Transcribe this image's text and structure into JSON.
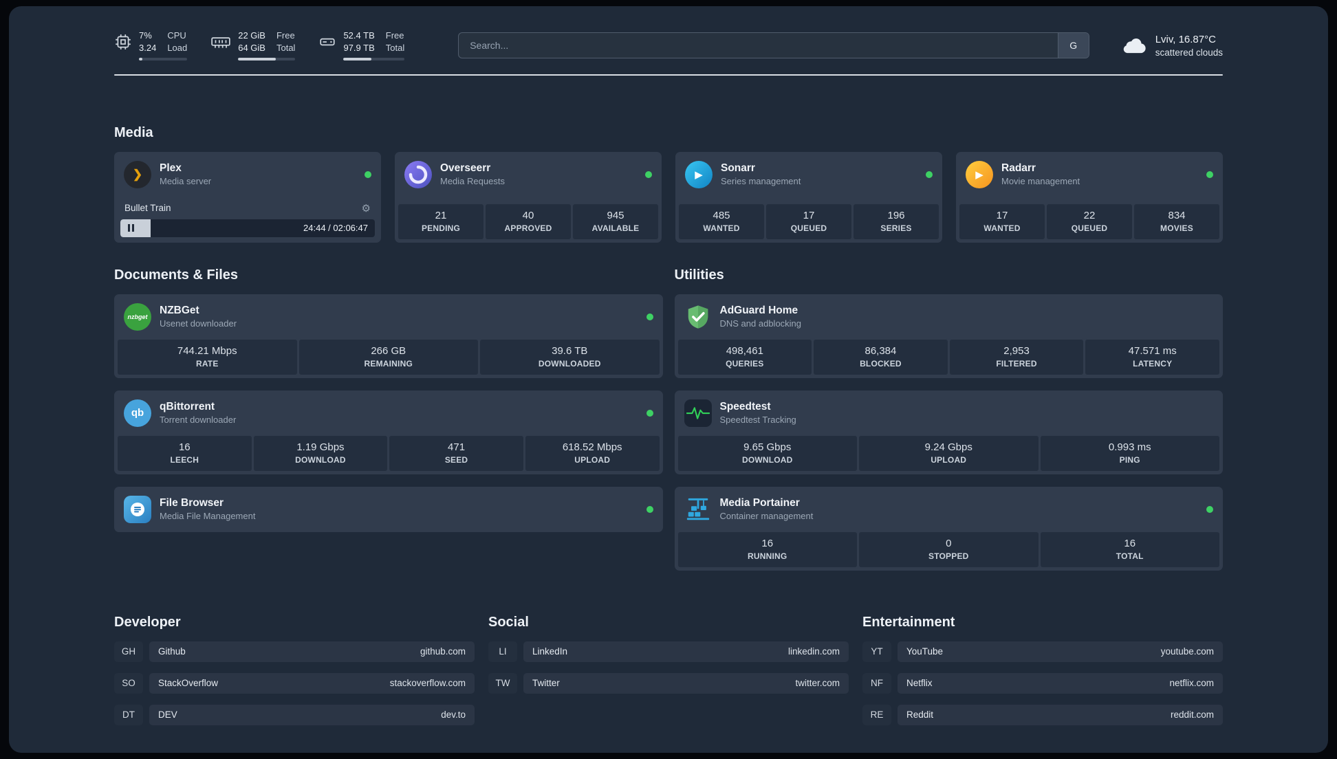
{
  "header": {
    "cpu": {
      "value_primary": "7%",
      "value_secondary": "3.24",
      "label_primary": "CPU",
      "label_secondary": "Load",
      "progress_pct": 7
    },
    "memory": {
      "value_primary": "22 GiB",
      "value_secondary": "64 GiB",
      "label_primary": "Free",
      "label_secondary": "Total",
      "progress_pct": 66
    },
    "disk": {
      "value_primary": "52.4 TB",
      "value_secondary": "97.9 TB",
      "label_primary": "Free",
      "label_secondary": "Total",
      "progress_pct": 46
    },
    "search": {
      "placeholder": "Search...",
      "engine_button": "G"
    },
    "weather": {
      "location": "Lviv, 16.87°C",
      "condition": "scattered clouds"
    }
  },
  "icons": {
    "gear": "⚙",
    "plex_chevron": "❯",
    "play": "▶",
    "nzbget_text": "nzbget",
    "qbittorrent_text": "qb"
  },
  "sections": {
    "media": "Media",
    "documents": "Documents & Files",
    "utilities": "Utilities",
    "developer": "Developer",
    "social": "Social",
    "entertainment": "Entertainment"
  },
  "services": {
    "plex": {
      "name": "Plex",
      "subtitle": "Media server",
      "now_playing": "Bullet Train",
      "time": "24:44 / 02:06:47",
      "progress_pct": 12
    },
    "overseerr": {
      "name": "Overseerr",
      "subtitle": "Media Requests",
      "stats": [
        {
          "value": "21",
          "label": "PENDING"
        },
        {
          "value": "40",
          "label": "APPROVED"
        },
        {
          "value": "945",
          "label": "AVAILABLE"
        }
      ]
    },
    "sonarr": {
      "name": "Sonarr",
      "subtitle": "Series management",
      "stats": [
        {
          "value": "485",
          "label": "WANTED"
        },
        {
          "value": "17",
          "label": "QUEUED"
        },
        {
          "value": "196",
          "label": "SERIES"
        }
      ]
    },
    "radarr": {
      "name": "Radarr",
      "subtitle": "Movie management",
      "stats": [
        {
          "value": "17",
          "label": "WANTED"
        },
        {
          "value": "22",
          "label": "QUEUED"
        },
        {
          "value": "834",
          "label": "MOVIES"
        }
      ]
    },
    "nzbget": {
      "name": "NZBGet",
      "subtitle": "Usenet downloader",
      "stats": [
        {
          "value": "744.21 Mbps",
          "label": "RATE"
        },
        {
          "value": "266 GB",
          "label": "REMAINING"
        },
        {
          "value": "39.6 TB",
          "label": "DOWNLOADED"
        }
      ]
    },
    "qbittorrent": {
      "name": "qBittorrent",
      "subtitle": "Torrent downloader",
      "stats": [
        {
          "value": "16",
          "label": "LEECH"
        },
        {
          "value": "1.19 Gbps",
          "label": "DOWNLOAD"
        },
        {
          "value": "471",
          "label": "SEED"
        },
        {
          "value": "618.52 Mbps",
          "label": "UPLOAD"
        }
      ]
    },
    "filebrowser": {
      "name": "File Browser",
      "subtitle": "Media File Management"
    },
    "adguard": {
      "name": "AdGuard Home",
      "subtitle": "DNS and adblocking",
      "stats": [
        {
          "value": "498,461",
          "label": "QUERIES"
        },
        {
          "value": "86,384",
          "label": "BLOCKED"
        },
        {
          "value": "2,953",
          "label": "FILTERED"
        },
        {
          "value": "47.571 ms",
          "label": "LATENCY"
        }
      ]
    },
    "speedtest": {
      "name": "Speedtest",
      "subtitle": "Speedtest Tracking",
      "stats": [
        {
          "value": "9.65 Gbps",
          "label": "DOWNLOAD"
        },
        {
          "value": "9.24 Gbps",
          "label": "UPLOAD"
        },
        {
          "value": "0.993 ms",
          "label": "PING"
        }
      ]
    },
    "portainer": {
      "name": "Media Portainer",
      "subtitle": "Container management",
      "stats": [
        {
          "value": "16",
          "label": "RUNNING"
        },
        {
          "value": "0",
          "label": "STOPPED"
        },
        {
          "value": "16",
          "label": "TOTAL"
        }
      ]
    }
  },
  "links": {
    "developer": [
      {
        "abbr": "GH",
        "name": "Github",
        "url": "github.com"
      },
      {
        "abbr": "SO",
        "name": "StackOverflow",
        "url": "stackoverflow.com"
      },
      {
        "abbr": "DT",
        "name": "DEV",
        "url": "dev.to"
      }
    ],
    "social": [
      {
        "abbr": "LI",
        "name": "LinkedIn",
        "url": "linkedin.com"
      },
      {
        "abbr": "TW",
        "name": "Twitter",
        "url": "twitter.com"
      }
    ],
    "entertainment": [
      {
        "abbr": "YT",
        "name": "YouTube",
        "url": "youtube.com"
      },
      {
        "abbr": "NF",
        "name": "Netflix",
        "url": "netflix.com"
      },
      {
        "abbr": "RE",
        "name": "Reddit",
        "url": "reddit.com"
      }
    ]
  },
  "colors": {
    "status_online": "#3ed164",
    "plex_accent": "#e5a00d"
  }
}
